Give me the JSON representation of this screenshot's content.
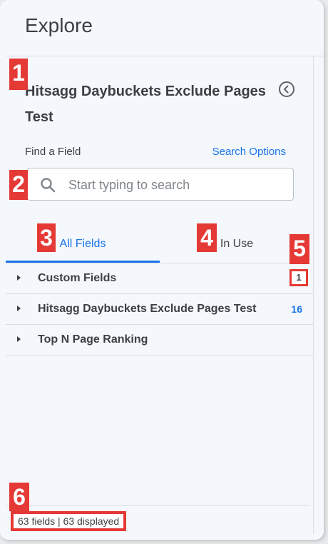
{
  "header": {
    "title": "Explore"
  },
  "model": {
    "title": "Hitsagg Daybuckets Exclude Pages Test"
  },
  "find": {
    "label": "Find a Field",
    "search_options": "Search Options",
    "placeholder": "Start typing to search"
  },
  "tabs": [
    {
      "label": "All Fields",
      "active": true
    },
    {
      "label": "In Use",
      "active": false
    }
  ],
  "rows": [
    {
      "label": "Custom Fields",
      "count": "1"
    },
    {
      "label": "Hitsagg Daybuckets Exclude Pages Test",
      "count": "16"
    },
    {
      "label": "Top N Page Ranking",
      "count": ""
    }
  ],
  "footer": {
    "summary": "63 fields | 63 displayed"
  },
  "badges": [
    "1",
    "2",
    "3",
    "4",
    "5",
    "6"
  ],
  "colors": {
    "accent": "#1a73e8",
    "badge": "#e53935",
    "panel_bg": "#f4f8fd"
  }
}
